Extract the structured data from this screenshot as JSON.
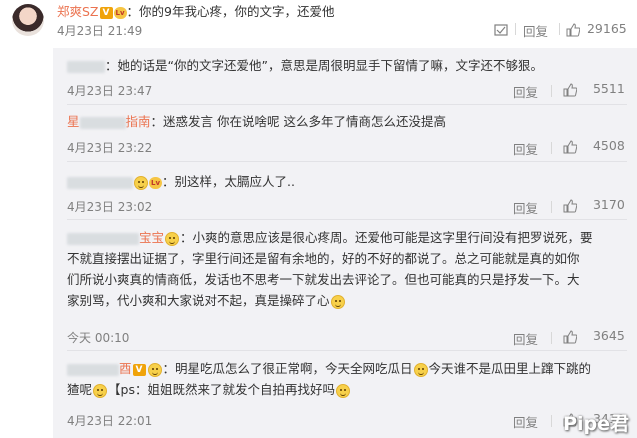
{
  "top": {
    "username": "郑爽SZ",
    "text": "：你的9年我心疼，你的文字，还爱他",
    "time": "4月23日 21:49",
    "share_label": "☑",
    "reply_label": "回复",
    "likes": "29165"
  },
  "comments": [
    {
      "user_suffix": "",
      "text": "：她的话是“你的文字还爱他”，意思是周很明显手下留情了嘛，文字还不够狠。",
      "time": "4月23日 23:47",
      "reply": "回复",
      "likes": "5511"
    },
    {
      "user_prefix": "星",
      "user_suffix": "指南",
      "text": "：迷惑发言 你在说啥呢 这么多年了情商怎么还没提高",
      "time": "4月23日 23:22",
      "reply": "回复",
      "likes": "4508"
    },
    {
      "text": "：别这样，太膈应人了..",
      "time": "4月23日 23:02",
      "reply": "回复",
      "likes": "3170"
    },
    {
      "user_suffix": "宝宝",
      "lines": [
        "：小爽的意思应该是很心疼周。还爱他可能是这字里行间没有把罗说死，要",
        "不就直接摆出证据了，字里行间还是留有余地的，好的不好的都说了。总之可能就是真的如你",
        "们所说小爽真的情商低，发话也不思考一下就发出去评论了。但也可能真的只是抒发一下。大",
        "家别骂，代小爽和大家说对不起，真是操碎了心"
      ],
      "time": "今天 00:10",
      "reply": "回复",
      "likes": "3645"
    },
    {
      "user_suffix": "酉",
      "lines": [
        "：明星吃瓜怎么了很正常啊，今天全网吃瓜日",
        "今天谁不是瓜田里上蹿下跳的",
        "猹呢",
        "【ps：姐姐既然来了就发个自拍再找好吗"
      ],
      "time": "4月23日 22:01",
      "reply": "回复",
      "likes": "3410"
    }
  ],
  "watermark": "Pipe君"
}
